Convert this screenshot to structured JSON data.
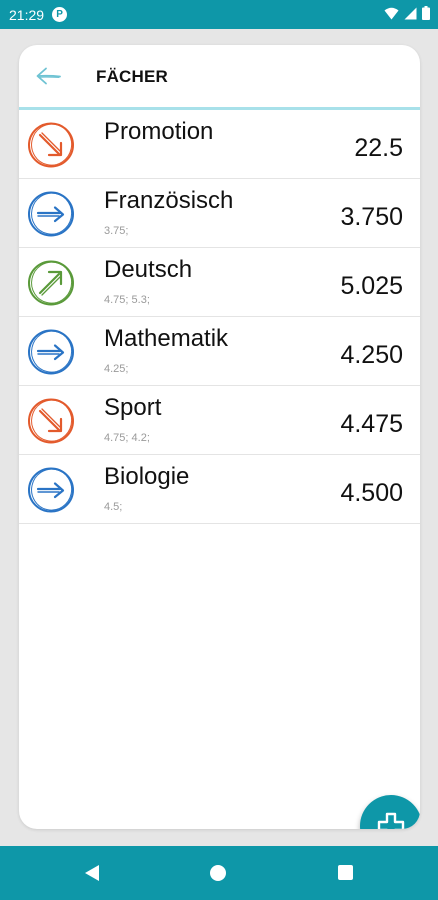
{
  "status_bar": {
    "time": "21:29",
    "badge": "P"
  },
  "header": {
    "title": "FÄCHER"
  },
  "subjects": [
    {
      "name": "Promotion",
      "grades": "",
      "value": "22.5",
      "trend": "down",
      "color": "#e35a2c"
    },
    {
      "name": "Französisch",
      "grades": "3.75;",
      "value": "3.750",
      "trend": "flat",
      "color": "#2a74c5"
    },
    {
      "name": "Deutsch",
      "grades": "4.75; 5.3;",
      "value": "5.025",
      "trend": "up",
      "color": "#5a9a3a"
    },
    {
      "name": "Mathematik",
      "grades": "4.25;",
      "value": "4.250",
      "trend": "flat",
      "color": "#2a74c5"
    },
    {
      "name": "Sport",
      "grades": "4.75; 4.2;",
      "value": "4.475",
      "trend": "down",
      "color": "#e35a2c"
    },
    {
      "name": "Biologie",
      "grades": "4.5;",
      "value": "4.500",
      "trend": "flat",
      "color": "#2a74c5"
    }
  ],
  "fab": {
    "icon": "plus-icon"
  },
  "icons": {
    "back": "arrow-left-icon",
    "trend_down": "trend-down-arrow-icon",
    "trend_flat": "trend-flat-arrow-icon",
    "trend_up": "trend-up-arrow-icon"
  },
  "colors": {
    "accent": "#0e97a8",
    "header_underline": "#a8e1ea"
  }
}
